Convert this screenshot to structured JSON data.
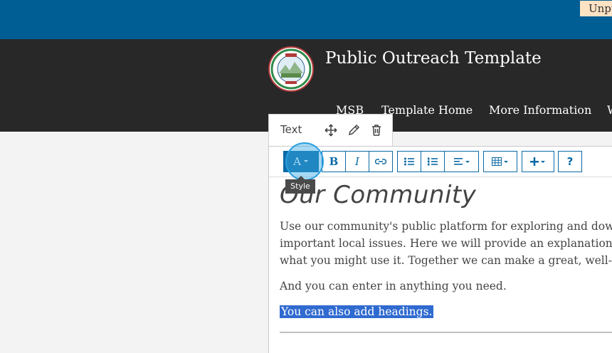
{
  "site": {
    "title": "Public Outreach Template",
    "unpublished_badge": "Unpublished"
  },
  "nav": {
    "items": [
      "MSB",
      "Template Home",
      "More Information",
      "W"
    ]
  },
  "widget": {
    "label": "Text",
    "icons": [
      "move-icon",
      "edit-icon",
      "delete-icon"
    ]
  },
  "toolbar": {
    "style_label": "A",
    "bold_label": "B",
    "italic_label": "I",
    "help_label": "?",
    "tooltip": "Style"
  },
  "content": {
    "heading": "Our Community",
    "paragraph_lines": [
      "Use our community's public platform for exploring and down",
      "important local issues. Here we will provide an explanation o",
      "what you might use it. Together we can make a great, well-co"
    ],
    "paragraph2": "And you can enter in anything you need.",
    "selected_text": "You can also add headings."
  },
  "colors": {
    "top_bar": "#005e95",
    "header": "#282828",
    "accent": "#0a6aa5",
    "selection": "#2f6ad0"
  }
}
